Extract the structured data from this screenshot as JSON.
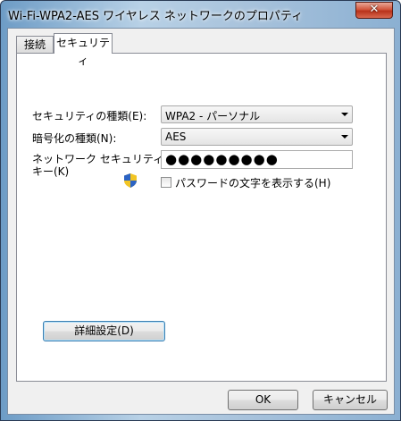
{
  "window": {
    "title": "Wi-Fi-WPA2-AES ワイヤレス ネットワークのプロパティ",
    "close_glyph": "✕"
  },
  "tabs": [
    {
      "label": "接続",
      "active": false
    },
    {
      "label": "セキュリティ",
      "active": true
    }
  ],
  "security": {
    "security_type_label": "セキュリティの種類(E):",
    "security_type_value": "WPA2 - パーソナル",
    "encryption_type_label": "暗号化の種類(N):",
    "encryption_type_value": "AES",
    "network_key_label_line1": "ネットワーク セキュリティ",
    "network_key_label_line2": "キー(K)",
    "network_key_value": "●●●●●●●●●",
    "show_password_label": "パスワードの文字を表示する(H)",
    "show_password_checked": false,
    "advanced_button": "詳細設定(D)"
  },
  "footer": {
    "ok_label": "OK",
    "cancel_label": "キャンセル"
  },
  "colors": {
    "shield_blue": "#2b63c4",
    "shield_yellow": "#f2c524",
    "close_red": "#c8452c"
  },
  "icons": {
    "uac_shield": "shield-icon",
    "close": "close-icon",
    "dropdown": "chevron-down-icon"
  }
}
